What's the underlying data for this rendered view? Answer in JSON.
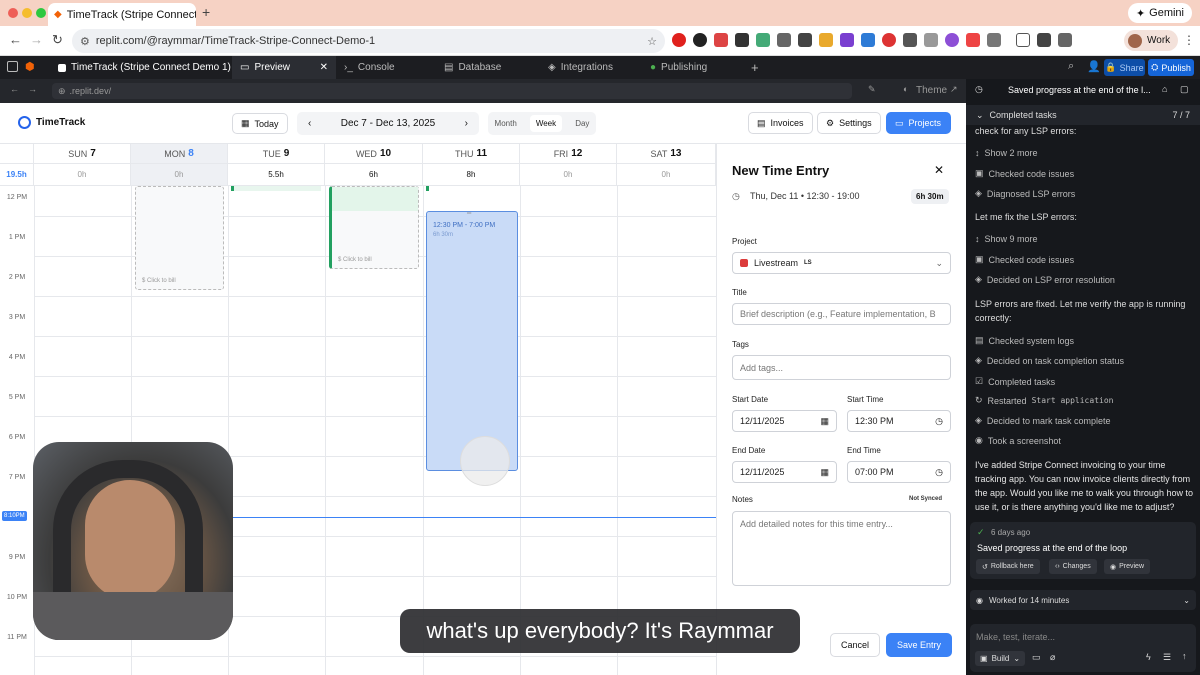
{
  "browser": {
    "tab_title": "TimeTrack (Stripe Connect De...",
    "gemini": "Gemini",
    "url": "replit.com/@raymmar/TimeTrack-Stripe-Connect-Demo-1",
    "profile": "Work"
  },
  "replit": {
    "tabs": [
      "TimeTrack (Stripe Connect Demo 1)",
      "Preview",
      "Console",
      "Database",
      "Integrations",
      "Publishing"
    ],
    "share": "Share",
    "publish": "Publish",
    "dev_url": ".replit.dev/",
    "theme": "Theme"
  },
  "app": {
    "name": "TimeTrack",
    "today": "Today",
    "range": "Dec 7 - Dec 13, 2025",
    "views": [
      "Month",
      "Week",
      "Day"
    ],
    "invoices": "Invoices",
    "settings": "Settings",
    "projects": "Projects"
  },
  "calendar": {
    "total": "19.5h",
    "days": [
      {
        "dow": "SUN",
        "num": "7",
        "hours": "0h"
      },
      {
        "dow": "MON",
        "num": "8",
        "hours": "0h"
      },
      {
        "dow": "TUE",
        "num": "9",
        "hours": "5.5h"
      },
      {
        "dow": "WED",
        "num": "10",
        "hours": "6h"
      },
      {
        "dow": "THU",
        "num": "11",
        "hours": "8h"
      },
      {
        "dow": "FRI",
        "num": "12",
        "hours": "0h"
      },
      {
        "dow": "SAT",
        "num": "13",
        "hours": "0h"
      }
    ],
    "times": [
      "12 PM",
      "1 PM",
      "2 PM",
      "3 PM",
      "4 PM",
      "5 PM",
      "6 PM",
      "7 PM",
      "9 PM",
      "10 PM",
      "11 PM"
    ],
    "now": "8:10PM",
    "click_to_bill": "Click to bill",
    "sel_time": "12:30 PM - 7:00 PM",
    "sel_dur": "6h 30m"
  },
  "entry": {
    "title": "New Time Entry",
    "when": "Thu, Dec 11 • 12:30 - 19:00",
    "duration": "6h 30m",
    "project_label": "Project",
    "project": "Livestream",
    "project_tag": "LS",
    "title_label": "Title",
    "title_ph": "Brief description (e.g., Feature implementation, B",
    "tags_label": "Tags",
    "tags_ph": "Add tags...",
    "start_date_label": "Start Date",
    "start_date": "12/11/2025",
    "start_time_label": "Start Time",
    "start_time": "12:30 PM",
    "end_date_label": "End Date",
    "end_date": "12/11/2025",
    "end_time_label": "End Time",
    "end_time": "07:00 PM",
    "notes_label": "Notes",
    "not_synced": "Not Synced",
    "notes_ph": "Add detailed notes for this time entry...",
    "cancel": "Cancel",
    "save": "Save Entry"
  },
  "agent": {
    "header": "Saved progress at the end of the l...",
    "completed": "Completed tasks",
    "count": "7 / 7",
    "l1": "check for any LSP errors:",
    "l2": "Show 2 more",
    "l3": "Checked code issues",
    "l4": "Diagnosed LSP errors",
    "l5": "Let me fix the LSP errors:",
    "l6": "Show 9 more",
    "l7": "Checked code issues",
    "l8": "Decided on LSP error resolution",
    "l9": "LSP errors are fixed. Let me verify the app is running correctly:",
    "l10": "Checked system logs",
    "l11": "Decided on task completion status",
    "l12": "Completed tasks",
    "l13a": "Restarted ",
    "l13b": "Start application",
    "l14": "Decided to mark task complete",
    "l15": "Took a screenshot",
    "msg": "I've added Stripe Connect invoicing to your time tracking app. You can now invoice clients directly from the app. Would you like me to walk you through how to use it, or is there anything you'd like me to adjust?",
    "ago": "6 days ago",
    "saved": "Saved progress at the end of the loop",
    "rollback": "Rollback here",
    "changes": "Changes",
    "preview": "Preview",
    "worked": "Worked for 14 minutes",
    "input_ph": "Make, test, iterate...",
    "build": "Build"
  },
  "caption": "what's up everybody? It's Raymmar"
}
